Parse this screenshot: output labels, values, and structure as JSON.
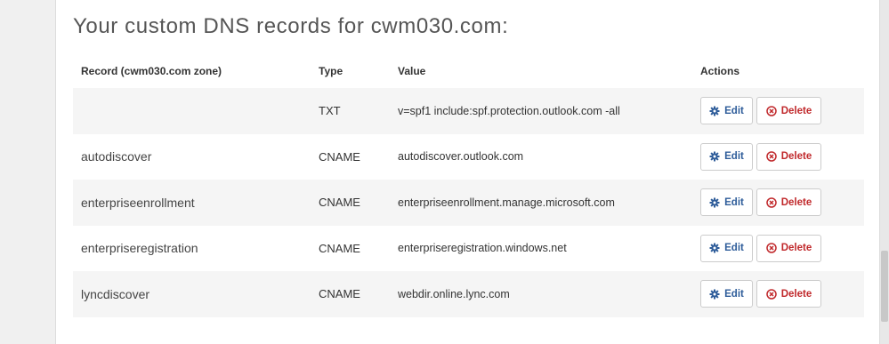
{
  "title": "Your custom DNS records for cwm030.com:",
  "table": {
    "headers": {
      "record": "Record (cwm030.com zone)",
      "type": "Type",
      "value": "Value",
      "actions": "Actions"
    },
    "rows": [
      {
        "record": "",
        "type": "TXT",
        "value": "v=spf1 include:spf.protection.outlook.com -all"
      },
      {
        "record": "autodiscover",
        "type": "CNAME",
        "value": "autodiscover.outlook.com"
      },
      {
        "record": "enterpriseenrollment",
        "type": "CNAME",
        "value": "enterpriseenrollment.manage.microsoft.com"
      },
      {
        "record": "enterpriseregistration",
        "type": "CNAME",
        "value": "enterpriseregistration.windows.net"
      },
      {
        "record": "lyncdiscover",
        "type": "CNAME",
        "value": "webdir.online.lync.com"
      }
    ]
  },
  "actions": {
    "edit_label": "Edit",
    "delete_label": "Delete",
    "edit_icon": "gear-icon",
    "delete_icon": "circle-x-icon"
  },
  "colors": {
    "edit": "#2f5d9a",
    "delete": "#c0282b",
    "row_shade": "#f5f5f5"
  }
}
